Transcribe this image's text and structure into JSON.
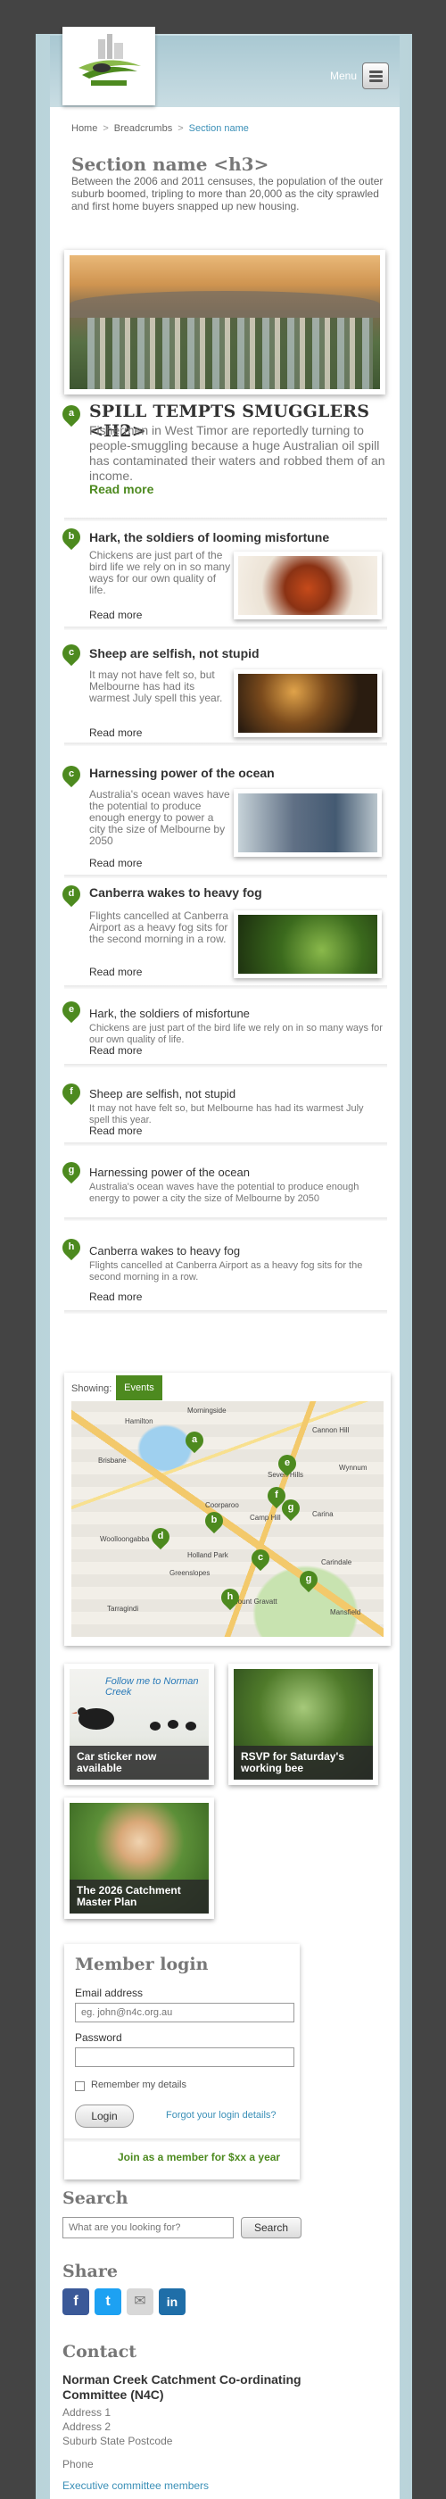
{
  "header": {
    "menu_label": "Menu"
  },
  "breadcrumbs": [
    "Home",
    "Breadcrumbs",
    "Section name"
  ],
  "section": {
    "title": "Section name <h3>",
    "intro": "Between the 2006 and 2011 censuses, the population of the outer suburb boomed, tripling to more than 20,000 as the city sprawled and first home buyers snapped up new housing."
  },
  "feature": {
    "marker": "a",
    "title": "SPILL TEMPTS SMUGGLERS <H2>",
    "body": "Fishermen in West Timor are reportedly turning to people-smuggling because a huge Australian oil spill has contaminated their waters and robbed them of an income.",
    "read_more": "Read more"
  },
  "image_items": [
    {
      "marker": "b",
      "title": "Hark, the soldiers of looming misfortune",
      "body": "Chickens are just part of the bird life we rely on in so many ways for our own quality of life.",
      "read_more": "Read more"
    },
    {
      "marker": "c",
      "title": "Sheep are selfish, not stupid",
      "body": "It may not have felt so, but Melbourne has had its warmest July spell this year.",
      "read_more": "Read more"
    },
    {
      "marker": "c",
      "title": "Harnessing power of the ocean",
      "body": "Australia's ocean waves have the potential to produce enough energy to power a city the size of Melbourne by 2050",
      "read_more": "Read more"
    },
    {
      "marker": "d",
      "title": "Canberra wakes to heavy fog",
      "body": "Flights cancelled at Canberra Airport as a heavy fog sits for the second morning in a row.",
      "read_more": "Read more"
    }
  ],
  "text_items": [
    {
      "marker": "e",
      "title": "Hark, the soldiers of misfortune",
      "body": "Chickens are just part of the bird life we rely on in so many ways for our own quality of life.",
      "read_more": "Read more"
    },
    {
      "marker": "f",
      "title": "Sheep are selfish, not stupid",
      "body": "It may not have felt so, but Melbourne has had its warmest July spell this year.",
      "read_more": "Read more"
    },
    {
      "marker": "g",
      "title": "Harnessing power of the ocean",
      "body": "Australia's ocean waves have the potential to produce enough energy to power a city the size of Melbourne by 2050",
      "read_more": "Read more"
    },
    {
      "marker": "h",
      "title": "Canberra wakes to heavy fog",
      "body": "Flights cancelled at Canberra Airport as a heavy fog sits for the second morning in a row.",
      "read_more": "Read more"
    }
  ],
  "map": {
    "showing_label": "Showing:",
    "events_button": "Events",
    "place_labels": [
      "Morningside",
      "Hamilton",
      "Cannon Hill",
      "Brisbane",
      "Seven Hills",
      "Wynnum",
      "Coorparoo",
      "Camp Hill",
      "Carina",
      "Woolloongabba",
      "Carindale",
      "Holland Park",
      "Mount Gravatt",
      "Tarragindi",
      "Greenslopes",
      "Mansfield"
    ],
    "markers": [
      "a",
      "b",
      "c",
      "d",
      "e",
      "f",
      "g",
      "h"
    ]
  },
  "promos": [
    {
      "caption": "Car sticker now available",
      "tile_text": "Follow me to Norman Creek"
    },
    {
      "caption": "RSVP for Saturday's working bee"
    },
    {
      "caption": "The 2026 Catchment Master Plan"
    }
  ],
  "login": {
    "title": "Member login",
    "email_label": "Email address",
    "email_placeholder": "eg. john@n4c.org.au",
    "password_label": "Password",
    "remember_label": "Remember my details",
    "login_button": "Login",
    "forgot_link": "Forgot your login details?",
    "join_link": "Join as a member for $xx a year"
  },
  "search": {
    "title": "Search",
    "placeholder": "What are you looking for?",
    "button": "Search"
  },
  "share": {
    "title": "Share",
    "buttons": [
      "f",
      "t",
      "✉",
      "in"
    ],
    "colors": [
      "#3b5998",
      "#1da1f2",
      "#d8d8d8",
      "#1f6ea8"
    ]
  },
  "contact": {
    "title": "Contact",
    "org": "Norman Creek Catchment Co-ordinating Committee (N4C)",
    "address1": "Address 1",
    "address2": "Address 2",
    "address3": "Suburb State Postcode",
    "phone": "Phone",
    "exec_link": "Executive committee members"
  },
  "colors": {
    "accent_green": "#4d8a1f",
    "link_blue": "#3a8fb7",
    "background": "#444444"
  }
}
